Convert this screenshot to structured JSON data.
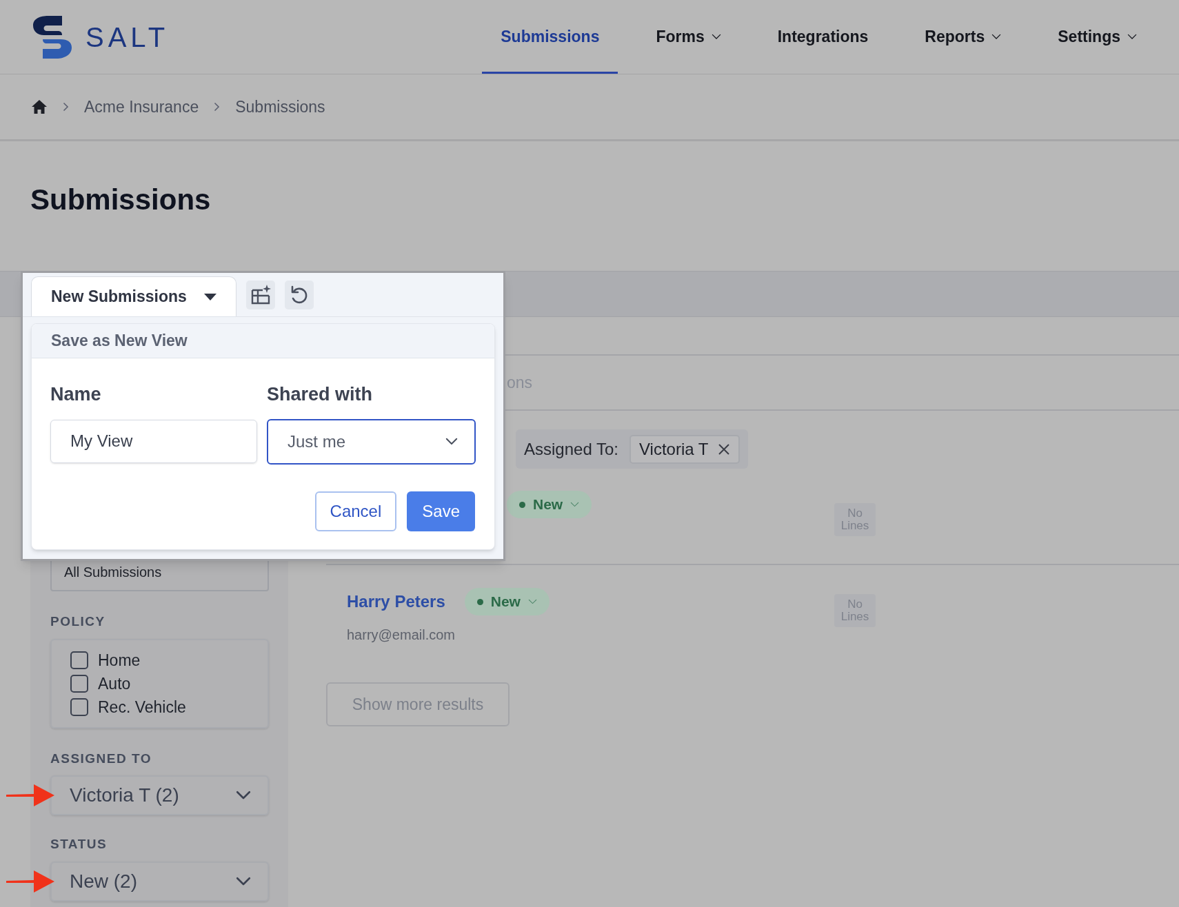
{
  "logo": {
    "text": "SALT"
  },
  "nav": [
    {
      "label": "Submissions",
      "selected": true,
      "dropdown": false
    },
    {
      "label": "Forms",
      "selected": false,
      "dropdown": true
    },
    {
      "label": "Integrations",
      "selected": false,
      "dropdown": false
    },
    {
      "label": "Reports",
      "selected": false,
      "dropdown": true
    },
    {
      "label": "Settings",
      "selected": false,
      "dropdown": true
    }
  ],
  "breadcrumb": [
    "Acme Insurance",
    "Submissions"
  ],
  "page_title": "Submissions",
  "view_tab": {
    "label": "New Submissions"
  },
  "save_view": {
    "title": "Save as New View",
    "name_label": "Name",
    "name_value": "My View",
    "shared_label": "Shared with",
    "shared_value": "Just me",
    "buttons": [
      {
        "label": "Cancel",
        "kind": "secondary"
      },
      {
        "label": "Save",
        "kind": "primary"
      }
    ]
  },
  "tab_fragment": "ons",
  "active_filter": {
    "label": "Assigned To:",
    "value": "Victoria T"
  },
  "rows": [
    {
      "status": "New",
      "lines": "No Lines"
    },
    {
      "name": "Harry Peters",
      "email": "harry@email.com",
      "status": "New",
      "lines": "No Lines"
    }
  ],
  "show_more": "Show more results",
  "sidebar": {
    "view_option": "All Submissions",
    "sections": [
      {
        "kind": "checkboxes",
        "title": "POLICY",
        "options": [
          {
            "label": "Home",
            "checked": false
          },
          {
            "label": "Auto",
            "checked": false
          },
          {
            "label": "Rec. Vehicle",
            "checked": false
          }
        ]
      },
      {
        "kind": "select",
        "title": "ASSIGNED TO",
        "value": "Victoria T (2)",
        "marked": true
      },
      {
        "kind": "select",
        "title": "STATUS",
        "value": "New (2)",
        "marked": true
      }
    ]
  }
}
